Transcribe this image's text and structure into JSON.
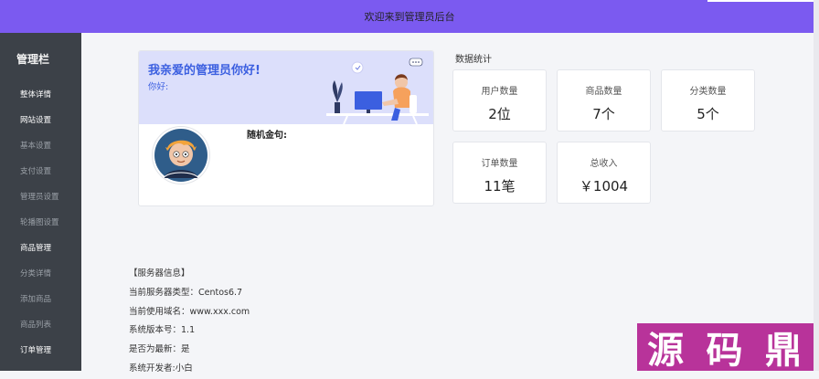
{
  "header": {
    "title": "欢迎来到管理员后台"
  },
  "sidebar": {
    "title": "管理栏",
    "items": [
      {
        "label": "整体详情",
        "style": "primary"
      },
      {
        "label": "网站设置",
        "style": "primary"
      },
      {
        "label": "基本设置",
        "style": "muted"
      },
      {
        "label": "支付设置",
        "style": "muted"
      },
      {
        "label": "管理员设置",
        "style": "muted"
      },
      {
        "label": "轮播图设置",
        "style": "muted"
      },
      {
        "label": "商品管理",
        "style": "primary"
      },
      {
        "label": "分类详情",
        "style": "muted"
      },
      {
        "label": "添加商品",
        "style": "muted"
      },
      {
        "label": "商品列表",
        "style": "muted"
      },
      {
        "label": "订单管理",
        "style": "primary"
      }
    ]
  },
  "welcome": {
    "title": "我亲爱的管理员你好!",
    "subtitle": "你好:",
    "motto_label": "随机金句:"
  },
  "stats": {
    "title": "数据统计",
    "cards": [
      {
        "label": "用户数量",
        "value": "2位"
      },
      {
        "label": "商品数量",
        "value": "7个"
      },
      {
        "label": "分类数量",
        "value": "5个"
      },
      {
        "label": "订单数量",
        "value": "11笔"
      },
      {
        "label": "总收入",
        "value": "￥1004"
      }
    ]
  },
  "server": {
    "heading": "【服务器信息】",
    "server_type": "当前服务器类型：Centos6.7",
    "domain": "当前使用域名：www.xxx.com",
    "version": "系统版本号：1.1",
    "latest": "是否为最新：是",
    "developer": "系统开发者:小白"
  },
  "watermark": {
    "chars": [
      "源",
      "码",
      "鼎"
    ]
  },
  "colors": {
    "header_bg": "#7b5af0",
    "sidebar_bg": "#3c4148",
    "banner_bg": "#dcdffb",
    "title_blue": "#3b5fe0",
    "watermark_bg": "#b8339a"
  }
}
